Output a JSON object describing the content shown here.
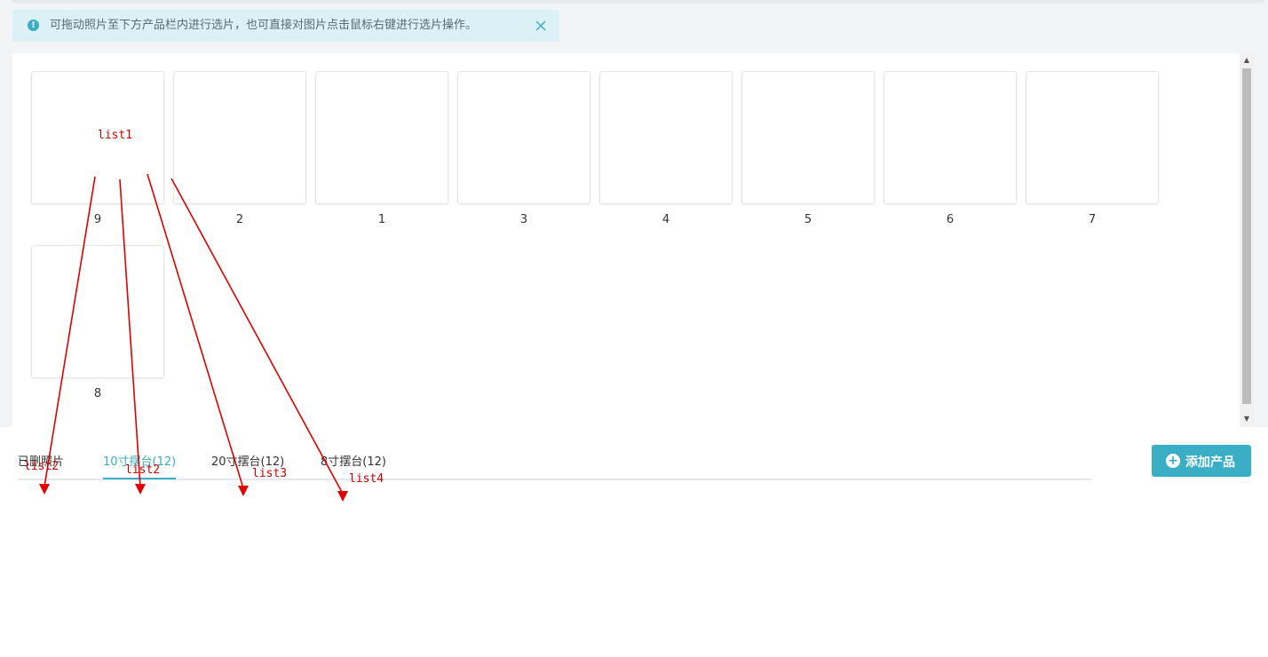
{
  "alert": {
    "text": "可拖动照片至下方产品栏内进行选片，也可直接对图片点击鼠标右键进行选片操作。",
    "icon": "info-icon",
    "close_icon": "close-icon"
  },
  "photos": [
    {
      "label": "9"
    },
    {
      "label": "2"
    },
    {
      "label": "1"
    },
    {
      "label": "3"
    },
    {
      "label": "4"
    },
    {
      "label": "5"
    },
    {
      "label": "6"
    },
    {
      "label": "7"
    },
    {
      "label": "8"
    }
  ],
  "tabs": [
    {
      "label": "已删照片",
      "active": false
    },
    {
      "label": "10寸摆台(12)",
      "active": true
    },
    {
      "label": "20寸摆台(12)",
      "active": false
    },
    {
      "label": "8寸摆台(12)",
      "active": false
    }
  ],
  "add_button": {
    "label": "添加产品",
    "icon": "plus-circle-icon"
  },
  "annotations": {
    "source": "list1",
    "targets": [
      "list2",
      "list2",
      "list3",
      "list4"
    ]
  },
  "colors": {
    "accent": "#3aaec4",
    "annotation": "#e00000",
    "alert_bg": "#dbf1f6"
  }
}
